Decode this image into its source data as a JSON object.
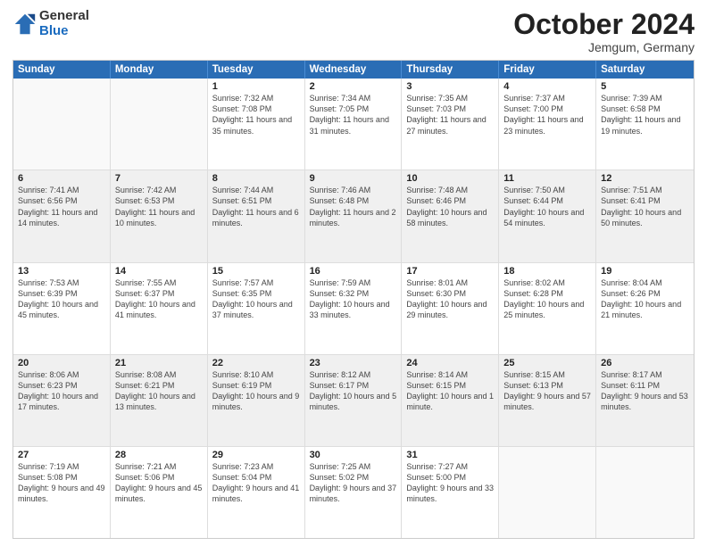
{
  "header": {
    "logo_general": "General",
    "logo_blue": "Blue",
    "month_title": "October 2024",
    "location": "Jemgum, Germany"
  },
  "weekdays": [
    "Sunday",
    "Monday",
    "Tuesday",
    "Wednesday",
    "Thursday",
    "Friday",
    "Saturday"
  ],
  "rows": [
    [
      {
        "day": "",
        "info": "",
        "empty": true
      },
      {
        "day": "",
        "info": "",
        "empty": true
      },
      {
        "day": "1",
        "info": "Sunrise: 7:32 AM\nSunset: 7:08 PM\nDaylight: 11 hours\nand 35 minutes."
      },
      {
        "day": "2",
        "info": "Sunrise: 7:34 AM\nSunset: 7:05 PM\nDaylight: 11 hours\nand 31 minutes."
      },
      {
        "day": "3",
        "info": "Sunrise: 7:35 AM\nSunset: 7:03 PM\nDaylight: 11 hours\nand 27 minutes."
      },
      {
        "day": "4",
        "info": "Sunrise: 7:37 AM\nSunset: 7:00 PM\nDaylight: 11 hours\nand 23 minutes."
      },
      {
        "day": "5",
        "info": "Sunrise: 7:39 AM\nSunset: 6:58 PM\nDaylight: 11 hours\nand 19 minutes."
      }
    ],
    [
      {
        "day": "6",
        "info": "Sunrise: 7:41 AM\nSunset: 6:56 PM\nDaylight: 11 hours\nand 14 minutes."
      },
      {
        "day": "7",
        "info": "Sunrise: 7:42 AM\nSunset: 6:53 PM\nDaylight: 11 hours\nand 10 minutes."
      },
      {
        "day": "8",
        "info": "Sunrise: 7:44 AM\nSunset: 6:51 PM\nDaylight: 11 hours\nand 6 minutes."
      },
      {
        "day": "9",
        "info": "Sunrise: 7:46 AM\nSunset: 6:48 PM\nDaylight: 11 hours\nand 2 minutes."
      },
      {
        "day": "10",
        "info": "Sunrise: 7:48 AM\nSunset: 6:46 PM\nDaylight: 10 hours\nand 58 minutes."
      },
      {
        "day": "11",
        "info": "Sunrise: 7:50 AM\nSunset: 6:44 PM\nDaylight: 10 hours\nand 54 minutes."
      },
      {
        "day": "12",
        "info": "Sunrise: 7:51 AM\nSunset: 6:41 PM\nDaylight: 10 hours\nand 50 minutes."
      }
    ],
    [
      {
        "day": "13",
        "info": "Sunrise: 7:53 AM\nSunset: 6:39 PM\nDaylight: 10 hours\nand 45 minutes."
      },
      {
        "day": "14",
        "info": "Sunrise: 7:55 AM\nSunset: 6:37 PM\nDaylight: 10 hours\nand 41 minutes."
      },
      {
        "day": "15",
        "info": "Sunrise: 7:57 AM\nSunset: 6:35 PM\nDaylight: 10 hours\nand 37 minutes."
      },
      {
        "day": "16",
        "info": "Sunrise: 7:59 AM\nSunset: 6:32 PM\nDaylight: 10 hours\nand 33 minutes."
      },
      {
        "day": "17",
        "info": "Sunrise: 8:01 AM\nSunset: 6:30 PM\nDaylight: 10 hours\nand 29 minutes."
      },
      {
        "day": "18",
        "info": "Sunrise: 8:02 AM\nSunset: 6:28 PM\nDaylight: 10 hours\nand 25 minutes."
      },
      {
        "day": "19",
        "info": "Sunrise: 8:04 AM\nSunset: 6:26 PM\nDaylight: 10 hours\nand 21 minutes."
      }
    ],
    [
      {
        "day": "20",
        "info": "Sunrise: 8:06 AM\nSunset: 6:23 PM\nDaylight: 10 hours\nand 17 minutes."
      },
      {
        "day": "21",
        "info": "Sunrise: 8:08 AM\nSunset: 6:21 PM\nDaylight: 10 hours\nand 13 minutes."
      },
      {
        "day": "22",
        "info": "Sunrise: 8:10 AM\nSunset: 6:19 PM\nDaylight: 10 hours\nand 9 minutes."
      },
      {
        "day": "23",
        "info": "Sunrise: 8:12 AM\nSunset: 6:17 PM\nDaylight: 10 hours\nand 5 minutes."
      },
      {
        "day": "24",
        "info": "Sunrise: 8:14 AM\nSunset: 6:15 PM\nDaylight: 10 hours\nand 1 minute."
      },
      {
        "day": "25",
        "info": "Sunrise: 8:15 AM\nSunset: 6:13 PM\nDaylight: 9 hours\nand 57 minutes."
      },
      {
        "day": "26",
        "info": "Sunrise: 8:17 AM\nSunset: 6:11 PM\nDaylight: 9 hours\nand 53 minutes."
      }
    ],
    [
      {
        "day": "27",
        "info": "Sunrise: 7:19 AM\nSunset: 5:08 PM\nDaylight: 9 hours\nand 49 minutes."
      },
      {
        "day": "28",
        "info": "Sunrise: 7:21 AM\nSunset: 5:06 PM\nDaylight: 9 hours\nand 45 minutes."
      },
      {
        "day": "29",
        "info": "Sunrise: 7:23 AM\nSunset: 5:04 PM\nDaylight: 9 hours\nand 41 minutes."
      },
      {
        "day": "30",
        "info": "Sunrise: 7:25 AM\nSunset: 5:02 PM\nDaylight: 9 hours\nand 37 minutes."
      },
      {
        "day": "31",
        "info": "Sunrise: 7:27 AM\nSunset: 5:00 PM\nDaylight: 9 hours\nand 33 minutes."
      },
      {
        "day": "",
        "info": "",
        "empty": true
      },
      {
        "day": "",
        "info": "",
        "empty": true
      }
    ]
  ]
}
